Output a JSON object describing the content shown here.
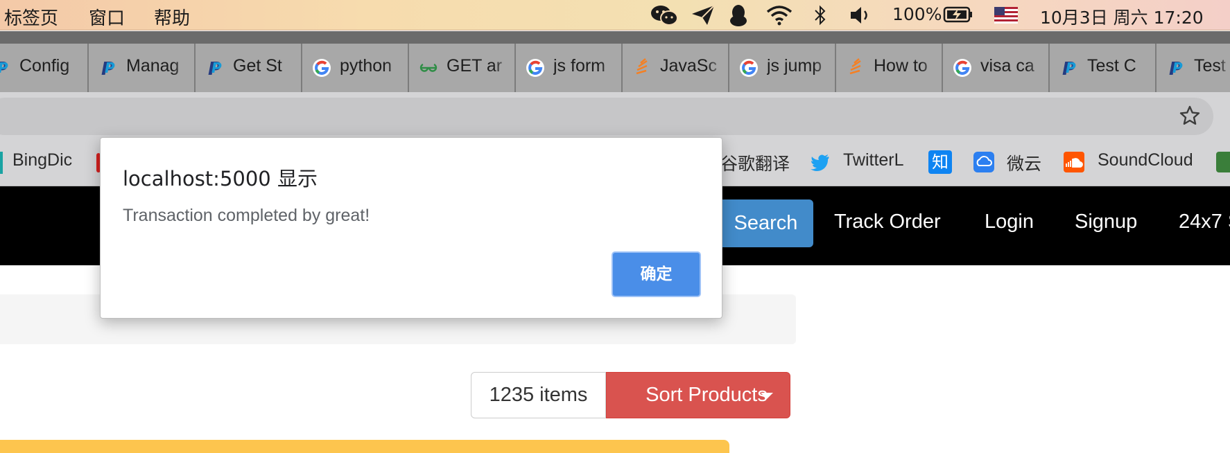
{
  "menubar": {
    "items": [
      "标签页",
      "窗口",
      "帮助"
    ],
    "battery": "100%",
    "datetime": "10月3日 周六  17:20"
  },
  "tabs": [
    {
      "label": "Config",
      "icon": "paypal-icon"
    },
    {
      "label": "Manag",
      "icon": "paypal-icon"
    },
    {
      "label": "Get St",
      "icon": "paypal-icon"
    },
    {
      "label": "python",
      "icon": "google-icon"
    },
    {
      "label": "GET ar",
      "icon": "geeksforgeeks-icon"
    },
    {
      "label": "js form",
      "icon": "google-icon"
    },
    {
      "label": "JavaSc",
      "icon": "stackoverflow-icon"
    },
    {
      "label": "js jump",
      "icon": "google-icon"
    },
    {
      "label": "How to",
      "icon": "stackoverflow-icon"
    },
    {
      "label": "visa ca",
      "icon": "google-icon"
    },
    {
      "label": "Test C",
      "icon": "paypal-icon"
    },
    {
      "label": "Test",
      "icon": "paypal-icon"
    }
  ],
  "bookmarks": [
    {
      "label": "BingDic"
    },
    {
      "label": "谷歌翻译"
    },
    {
      "label": "TwitterL"
    },
    {
      "label": "知"
    },
    {
      "label": "微云"
    },
    {
      "label": "SoundCloud"
    }
  ],
  "site_nav": {
    "search_label": "Search",
    "links": [
      "Track Order",
      "Login",
      "Signup",
      "24x7 S"
    ]
  },
  "toolbar": {
    "items_count": "1235 items",
    "sort_label": "Sort Products"
  },
  "dialog": {
    "title": "localhost:5000 显示",
    "message": "Transaction completed by great!",
    "ok_label": "确定"
  },
  "colors": {
    "search_button": "#428bca",
    "sort_button": "#d9534f",
    "ok_button": "#4a8ee8",
    "navbar": "#000000",
    "yellow_bar": "#fdc54e"
  }
}
